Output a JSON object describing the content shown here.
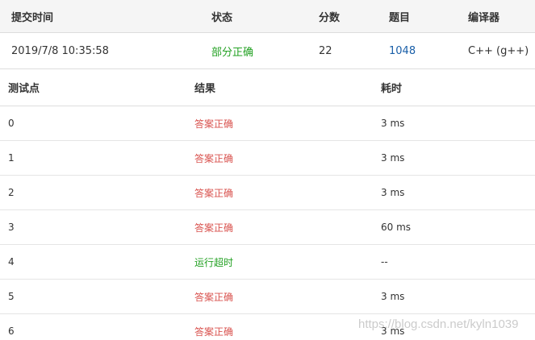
{
  "submission": {
    "headers": {
      "time": "提交时间",
      "status": "状态",
      "score": "分数",
      "problem": "题目",
      "compiler": "编译器"
    },
    "row": {
      "time": "2019/7/8 10:35:58",
      "status": "部分正确",
      "score": "22",
      "problem": "1048",
      "compiler": "C++ (g++)"
    }
  },
  "testcases": {
    "headers": {
      "id": "测试点",
      "result": "结果",
      "time": "耗时"
    },
    "rows": [
      {
        "id": "0",
        "result": "答案正确",
        "time": "3 ms"
      },
      {
        "id": "1",
        "result": "答案正确",
        "time": "3 ms"
      },
      {
        "id": "2",
        "result": "答案正确",
        "time": "3 ms"
      },
      {
        "id": "3",
        "result": "答案正确",
        "time": "60 ms"
      },
      {
        "id": "4",
        "result": "运行超时",
        "time": "--"
      },
      {
        "id": "5",
        "result": "答案正确",
        "time": "3 ms"
      },
      {
        "id": "6",
        "result": "答案正确",
        "time": "3 ms"
      }
    ]
  },
  "colors": {
    "accepted": "#d9534f",
    "timeout": "#23a123",
    "partial": "#23a123",
    "link": "#1a5fa8"
  },
  "watermark": "https://blog.csdn.net/kyln1039"
}
